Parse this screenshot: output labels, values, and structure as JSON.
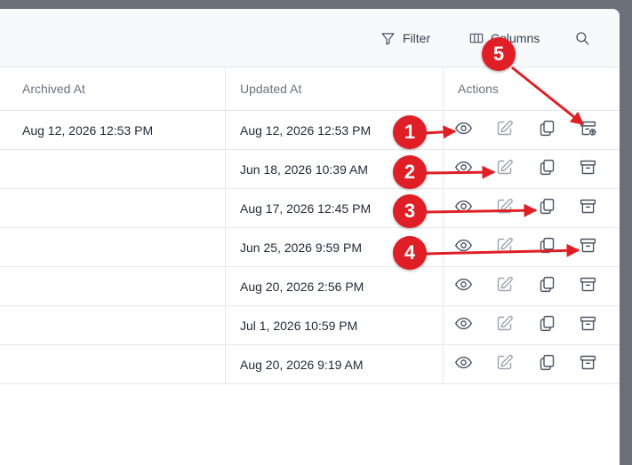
{
  "toolbar": {
    "filter_label": "Filter",
    "columns_label": "Columns",
    "filter_icon": "funnel-icon",
    "columns_icon": "columns-icon",
    "search_icon": "search-icon"
  },
  "table": {
    "headers": {
      "archived_at": "Archived At",
      "updated_at": "Updated At",
      "actions": "Actions"
    },
    "rows": [
      {
        "archived_at": "Aug 12, 2026 12:53 PM",
        "updated_at": "Aug 12, 2026 12:53 PM",
        "last_action": "unarchive"
      },
      {
        "archived_at": "",
        "updated_at": "Jun 18, 2026 10:39 AM",
        "last_action": "archive"
      },
      {
        "archived_at": "",
        "updated_at": "Aug 17, 2026 12:45 PM",
        "last_action": "archive"
      },
      {
        "archived_at": "",
        "updated_at": "Jun 25, 2026 9:59 PM",
        "last_action": "archive"
      },
      {
        "archived_at": "",
        "updated_at": "Aug 20, 2026 2:56 PM",
        "last_action": "archive"
      },
      {
        "archived_at": "",
        "updated_at": "Jul 1, 2026 10:59 PM",
        "last_action": "archive"
      },
      {
        "archived_at": "",
        "updated_at": "Aug 20, 2026 9:19 AM",
        "last_action": "archive"
      }
    ],
    "action_icons": [
      "eye-icon",
      "edit-icon",
      "copy-icon",
      "archive-icon"
    ]
  },
  "annotations": {
    "color": "#e01e26",
    "badges": [
      "1",
      "2",
      "3",
      "4",
      "5"
    ]
  }
}
